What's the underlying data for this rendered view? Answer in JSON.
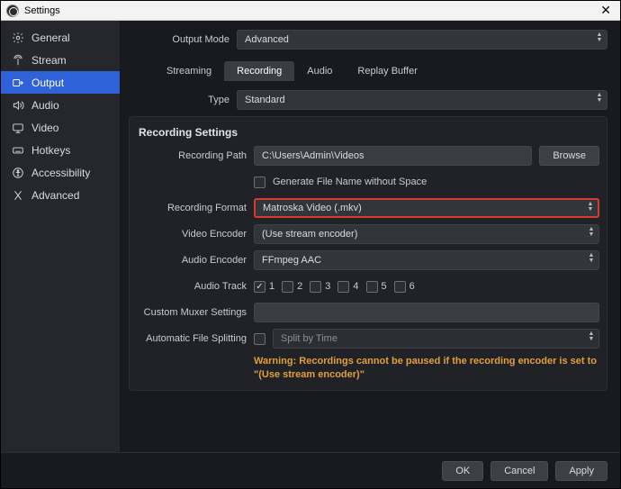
{
  "window": {
    "title": "Settings"
  },
  "sidebar": {
    "items": [
      {
        "label": "General"
      },
      {
        "label": "Stream"
      },
      {
        "label": "Output"
      },
      {
        "label": "Audio"
      },
      {
        "label": "Video"
      },
      {
        "label": "Hotkeys"
      },
      {
        "label": "Accessibility"
      },
      {
        "label": "Advanced"
      }
    ]
  },
  "top": {
    "output_mode_label": "Output Mode",
    "output_mode_value": "Advanced"
  },
  "tabs": {
    "streaming": "Streaming",
    "recording": "Recording",
    "audio": "Audio",
    "replay": "Replay Buffer"
  },
  "type_row": {
    "label": "Type",
    "value": "Standard"
  },
  "section": {
    "title": "Recording Settings"
  },
  "path_row": {
    "label": "Recording Path",
    "value": "C:\\Users\\Admin\\Videos",
    "browse": "Browse"
  },
  "nospace": {
    "label": "Generate File Name without Space"
  },
  "format_row": {
    "label": "Recording Format",
    "value": "Matroska Video (.mkv)"
  },
  "venc_row": {
    "label": "Video Encoder",
    "value": "(Use stream encoder)"
  },
  "aenc_row": {
    "label": "Audio Encoder",
    "value": "FFmpeg AAC"
  },
  "track_row": {
    "label": "Audio Track",
    "t1": "1",
    "t2": "2",
    "t3": "3",
    "t4": "4",
    "t5": "5",
    "t6": "6"
  },
  "muxer_row": {
    "label": "Custom Muxer Settings",
    "value": ""
  },
  "split_row": {
    "label": "Automatic File Splitting",
    "value": "Split by Time"
  },
  "warning": "Warning: Recordings cannot be paused if the recording encoder is set to \"(Use stream encoder)\"",
  "footer": {
    "ok": "OK",
    "cancel": "Cancel",
    "apply": "Apply"
  }
}
